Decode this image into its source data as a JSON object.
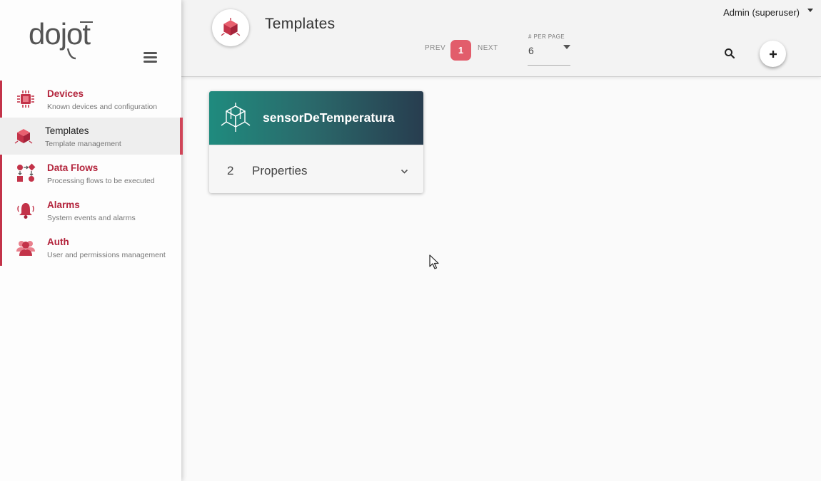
{
  "app": {
    "logo_text": "dojot"
  },
  "sidebar": {
    "menu_icon": "hamburger-menu-icon",
    "items": [
      {
        "label": "Devices",
        "description": "Known devices and configuration",
        "icon": "chip-icon",
        "active": false
      },
      {
        "label": "Templates",
        "description": "Template management",
        "icon": "cube-icon",
        "active": true
      },
      {
        "label": "Data Flows",
        "description": "Processing flows to be executed",
        "icon": "flow-icon",
        "active": false
      },
      {
        "label": "Alarms",
        "description": "System events and alarms",
        "icon": "bell-icon",
        "active": false
      },
      {
        "label": "Auth",
        "description": "User and permissions management",
        "icon": "users-icon",
        "active": false
      }
    ]
  },
  "header": {
    "title": "Templates",
    "title_icon": "cube-icon",
    "pagination": {
      "prev_label": "PREV",
      "current_page": "1",
      "next_label": "NEXT"
    },
    "per_page": {
      "label": "# PER PAGE",
      "value": "6"
    },
    "user": "Admin (superuser)",
    "search_icon": "search-icon",
    "add_icon": "plus-icon"
  },
  "cards": [
    {
      "title": "sensorDeTemperatura",
      "icon": "wireframe-cube-icon",
      "property_count": "2",
      "property_label": "Properties",
      "expand_icon": "chevron-down-icon"
    }
  ],
  "colors": {
    "accent": "#c33349",
    "page_badge": "#e25d6b",
    "card_gradient_start": "#1f8b7e",
    "card_gradient_end": "#283d4f"
  }
}
